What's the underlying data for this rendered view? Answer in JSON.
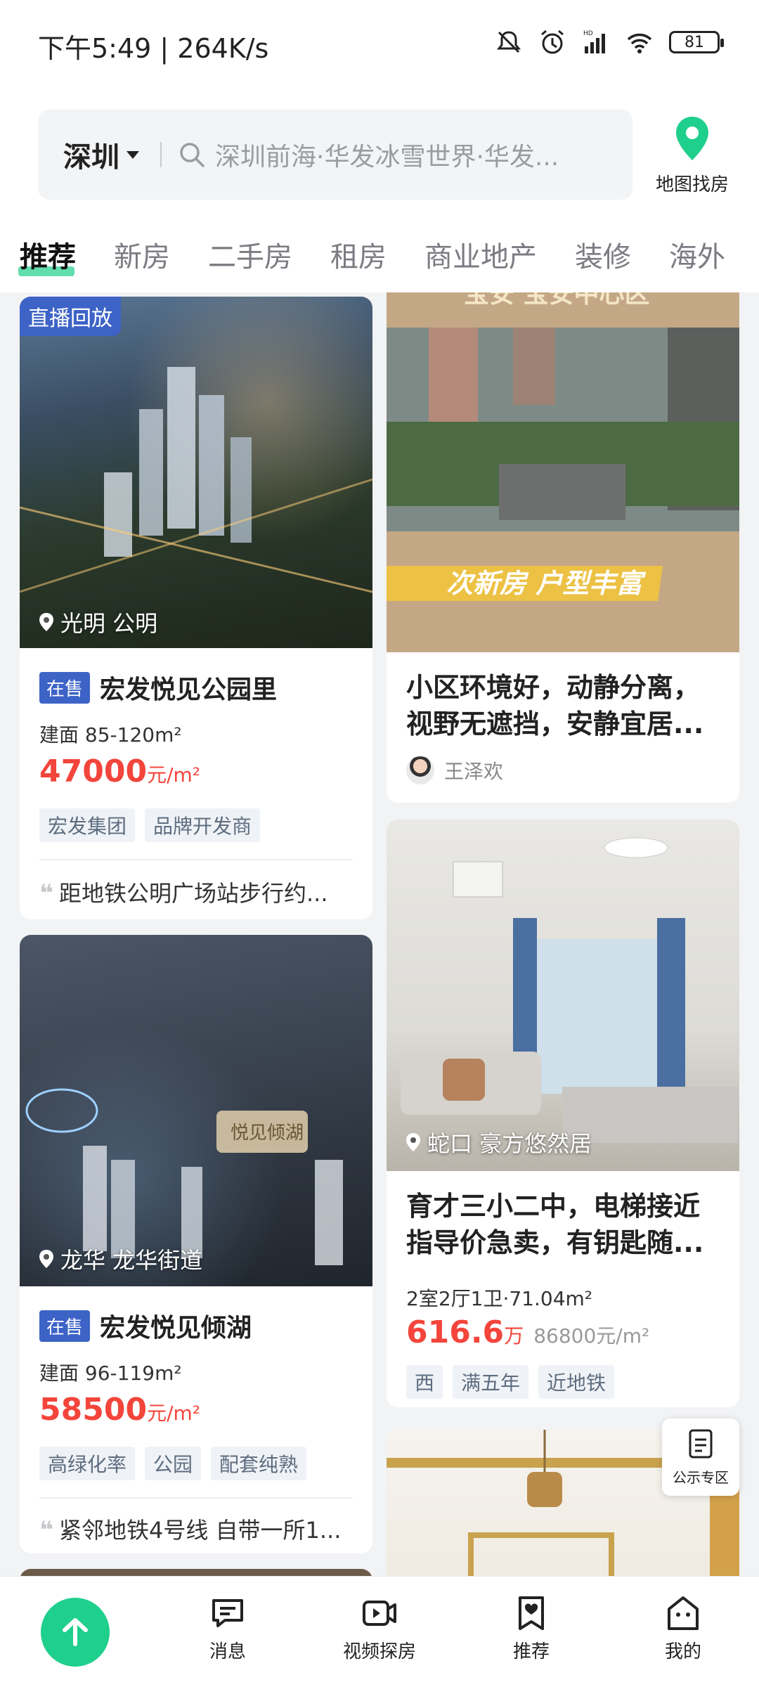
{
  "status_bar": {
    "time": "下午5:49 | 264K/s",
    "battery": "81"
  },
  "header": {
    "city": "深圳",
    "search_placeholder": "深圳前海·华发冰雪世界·华发...",
    "map_label": "地图找房"
  },
  "tabs": [
    "推荐",
    "新房",
    "二手房",
    "租房",
    "商业地产",
    "装修",
    "海外"
  ],
  "feed": {
    "left": [
      {
        "live_badge": "直播回放",
        "location": "光明 公明",
        "sale_tag": "在售",
        "title": "宏发悦见公园里",
        "area": "建面 85-120m²",
        "price": "47000",
        "price_unit": "元/m²",
        "chips": [
          "宏发集团",
          "品牌开发商"
        ],
        "quote": "距地铁公明广场站步行约..."
      },
      {
        "location": "龙华 龙华街道",
        "sale_tag": "在售",
        "title": "宏发悦见倾湖",
        "area": "建面 96-119m²",
        "price": "58500",
        "price_unit": "元/m²",
        "chips": [
          "高绿化率",
          "公园",
          "配套纯熟"
        ],
        "quote": "紧邻地铁4号线 自带一所1..."
      }
    ],
    "right": [
      {
        "image_caption_top": "宝安 宝安中心区",
        "image_caption": "次新房 户型丰富",
        "desc_line1": "小区环境好，动静分离，",
        "desc_line2": "视野无遮挡，安静宜居...",
        "agent": "王泽欢"
      },
      {
        "location": "蛇口 豪方悠然居",
        "desc_line1": "育才三小二中，电梯接近",
        "desc_line2": "指导价急卖，有钥匙随...",
        "rooms": "2室2厅1卫·71.04m²",
        "price": "616.6",
        "price_unit": "万",
        "unit_price": "86800元/m²",
        "chips": [
          "西",
          "满五年",
          "近地铁"
        ]
      }
    ]
  },
  "float_button": "公示专区",
  "bottom_nav": [
    "消息",
    "视频探房",
    "推荐",
    "我的"
  ],
  "colors": {
    "accent": "#1fcf8c",
    "price": "#f3453b",
    "sale_tag": "#3d63c7"
  }
}
